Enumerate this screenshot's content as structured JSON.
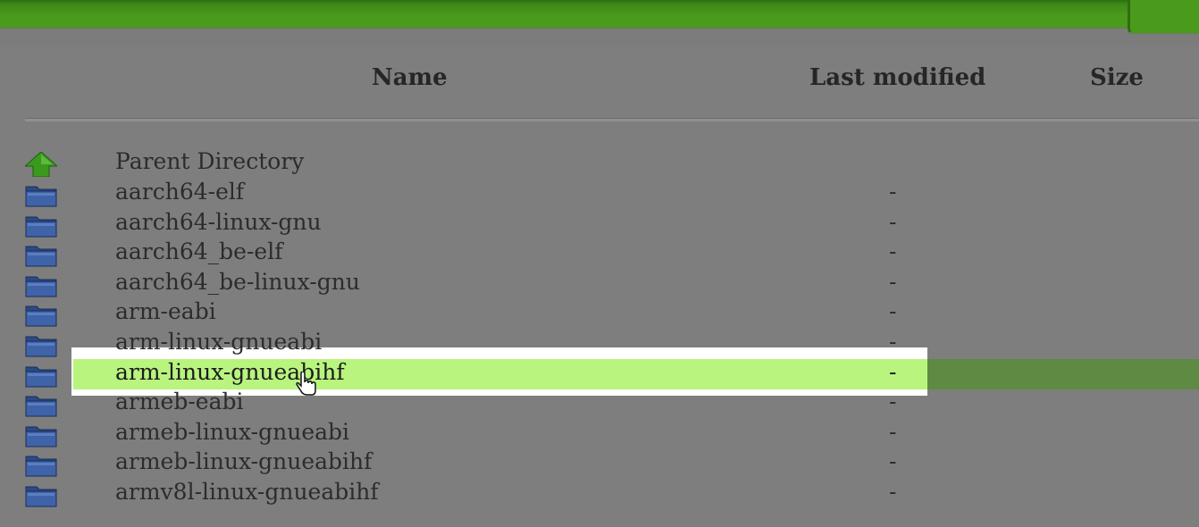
{
  "table": {
    "headers": {
      "name": "Name",
      "last_modified": "Last modified",
      "size": "Size"
    },
    "parent": {
      "label": "Parent Directory",
      "icon": "up-arrow-icon"
    },
    "rows": [
      {
        "name": "aarch64-elf",
        "modified": "-",
        "icon": "folder-icon"
      },
      {
        "name": "aarch64-linux-gnu",
        "modified": "-",
        "icon": "folder-icon"
      },
      {
        "name": "aarch64_be-elf",
        "modified": "-",
        "icon": "folder-icon"
      },
      {
        "name": "aarch64_be-linux-gnu",
        "modified": "-",
        "icon": "folder-icon"
      },
      {
        "name": "arm-eabi",
        "modified": "-",
        "icon": "folder-icon"
      },
      {
        "name": "arm-linux-gnueabi",
        "modified": "-",
        "icon": "folder-icon"
      },
      {
        "name": "arm-linux-gnueabihf",
        "modified": "-",
        "icon": "folder-icon",
        "selected": true
      },
      {
        "name": "armeb-eabi",
        "modified": "-",
        "icon": "folder-icon"
      },
      {
        "name": "armeb-linux-gnueabi",
        "modified": "-",
        "icon": "folder-icon"
      },
      {
        "name": "armeb-linux-gnueabihf",
        "modified": "-",
        "icon": "folder-icon"
      },
      {
        "name": "armv8l-linux-gnueabihf",
        "modified": "-",
        "icon": "folder-icon"
      }
    ]
  },
  "colors": {
    "header_bar": "#4a9a1c",
    "selected_row": "#b8f47e",
    "folder": "#3f63a8"
  }
}
